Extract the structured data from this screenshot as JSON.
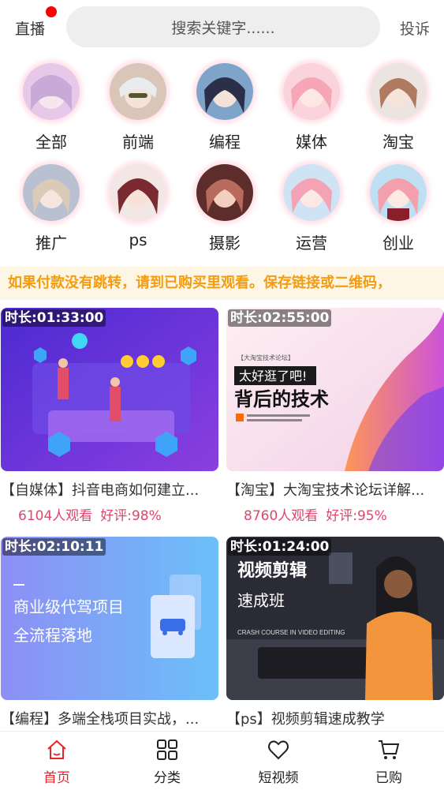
{
  "header": {
    "live_label": "直播",
    "search_placeholder": "搜索关键字......",
    "complain_label": "投诉"
  },
  "categories": [
    {
      "label": "全部",
      "color": "#e7c8e8"
    },
    {
      "label": "前端",
      "color": "#d9c6b8"
    },
    {
      "label": "编程",
      "color": "#7fa4c9"
    },
    {
      "label": "媒体",
      "color": "#f6a6b6"
    },
    {
      "label": "淘宝",
      "color": "#c9a08a"
    },
    {
      "label": "推广",
      "color": "#b9c0d2"
    },
    {
      "label": "ps",
      "color": "#8a3a40"
    },
    {
      "label": "摄影",
      "color": "#b86a5c"
    },
    {
      "label": "运营",
      "color": "#f4a3b5"
    },
    {
      "label": "创业",
      "color": "#f2a0ae"
    }
  ],
  "notice": "如果付款没有跳转，请到已购买里观看。保存链接或二维码，",
  "videos": [
    {
      "duration": "时长:01:33:00",
      "title": "【自媒体】抖音电商如何建立...",
      "views": "6104人观看",
      "rating": "好评:98%",
      "bg": "#6a3fd6"
    },
    {
      "duration": "时长:02:55:00",
      "title": "【淘宝】大淘宝技术论坛详解...",
      "views": "8760人观看",
      "rating": "好评:95%",
      "bg": "#f6d7e6",
      "thumb_text": {
        "small": "【大淘宝技术论坛】",
        "banner": "太好逛了吧!",
        "main": "背后的技术"
      }
    },
    {
      "duration": "时长:02:10:11",
      "title": "【编程】多端全栈项目实战，...",
      "bg": "#8fa2f5",
      "thumb_text": {
        "line1": "商业级代驾项目",
        "line2": "全流程落地"
      }
    },
    {
      "duration": "时长:01:24:00",
      "title": "【ps】视频剪辑速成教学",
      "bg": "#2b2b35",
      "thumb_text": {
        "line1": "视频剪辑",
        "line2": "速成班",
        "line3": "CRASH COURSE IN VIDEO EDITING"
      }
    }
  ],
  "tabbar": {
    "items": [
      {
        "label": "首页",
        "icon": "home-icon",
        "active": true
      },
      {
        "label": "分类",
        "icon": "grid-icon",
        "active": false
      },
      {
        "label": "短视频",
        "icon": "heart-icon",
        "active": false
      },
      {
        "label": "已购",
        "icon": "cart-icon",
        "active": false
      }
    ],
    "active_color": "#e8242a"
  }
}
